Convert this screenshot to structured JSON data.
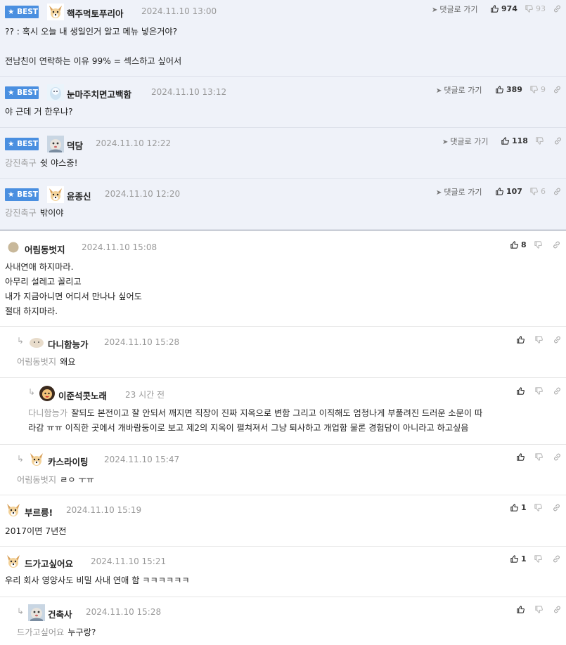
{
  "best_comments": [
    {
      "badge": "★ BEST",
      "nick": "핵주먹토푸리아",
      "date": "2024.11.10 13:00",
      "goto": "댓글로 가기",
      "up": "974",
      "down": "93",
      "mention": "",
      "text": "?? : 혹시 오늘 내 생일인거 알고 메뉴 넣은거야?\n\n전남친이 연락하는 이유 99% = 섹스하고 싶어서",
      "avatar": "dog-avatar"
    },
    {
      "badge": "★ BEST",
      "nick": "눈마주치면고백함",
      "date": "2024.11.10 13:12",
      "goto": "댓글로 가기",
      "up": "389",
      "down": "9",
      "mention": "",
      "text": "야 근데 거 한우냐?",
      "avatar": "ice-avatar"
    },
    {
      "badge": "★ BEST",
      "nick": "덕담",
      "date": "2024.11.10 12:22",
      "goto": "댓글로 가기",
      "up": "118",
      "down": "",
      "mention": "강진축구",
      "text": "쉿 야스중!",
      "avatar": "photo-avatar"
    },
    {
      "badge": "★ BEST",
      "nick": "윤종신",
      "date": "2024.11.10 12:20",
      "goto": "댓글로 가기",
      "up": "107",
      "down": "6",
      "mention": "강진축구",
      "text": "밖이야",
      "avatar": "dog-avatar"
    }
  ],
  "comments": [
    {
      "nick": "어림동벗지",
      "date": "2024.11.10 15:08",
      "up": "8",
      "mention": "",
      "text": "사내연애 하지마라.\n아무리 설레고 꼴리고\n내가 지금아니면 어디서 만나나 싶어도\n절대 하지마라.",
      "avatar": "circle-avatar"
    },
    {
      "nick": "다니함능가",
      "date": "2024.11.10 15:28",
      "up": "",
      "mention": "어림동벗지",
      "text": "왜요",
      "avatar": "cat-avatar"
    },
    {
      "nick": "이준석콧노래",
      "date": "23 시간 전",
      "up": "",
      "mention": "다니함능가",
      "text": "잘되도 본전이고 잘 안되서 깨지면 직장이 진짜 지옥으로 변함 그리고 이직해도 엄청나게 부풀려진 드러운 소문이 따\n라감 ㅠㅠ 이직한 곳에서 개바람둥이로 보고 제2의 지옥이 펼쳐져서 그냥 퇴사하고 개업함 물론 경험담이 아니라고 하고싶음",
      "avatar": "lion-avatar"
    },
    {
      "nick": "카스라이팅",
      "date": "2024.11.10 15:47",
      "up": "",
      "mention": "어림동벗지",
      "text": "ㄹㅇ ㅜㅠ",
      "avatar": "dog-avatar"
    },
    {
      "nick": "부르릉!",
      "date": "2024.11.10 15:19",
      "up": "1",
      "mention": "",
      "text": "2017이면 7년전",
      "avatar": "dog-avatar"
    },
    {
      "nick": "드가고싶어요",
      "date": "2024.11.10 15:21",
      "up": "1",
      "mention": "",
      "text": "우리 회사 영양사도 비밀 사내 연애 함 ㅋㅋㅋㅋㅋㅋ",
      "avatar": "dog-avatar"
    },
    {
      "nick": "건축사",
      "date": "2024.11.10 15:28",
      "up": "",
      "mention": "드가고싶어요",
      "text": "누구랑?",
      "avatar": "photo-avatar"
    }
  ],
  "icons": {
    "thumbs_up": "thumbs-up-icon",
    "thumbs_down": "thumbs-down-icon",
    "link": "link-icon",
    "reply": "reply-arrow-icon",
    "goto": "send-arrow-icon"
  },
  "colors": {
    "best_badge": "#4a8fe0",
    "best_bg": "#eff2f9",
    "muted": "#999999"
  }
}
